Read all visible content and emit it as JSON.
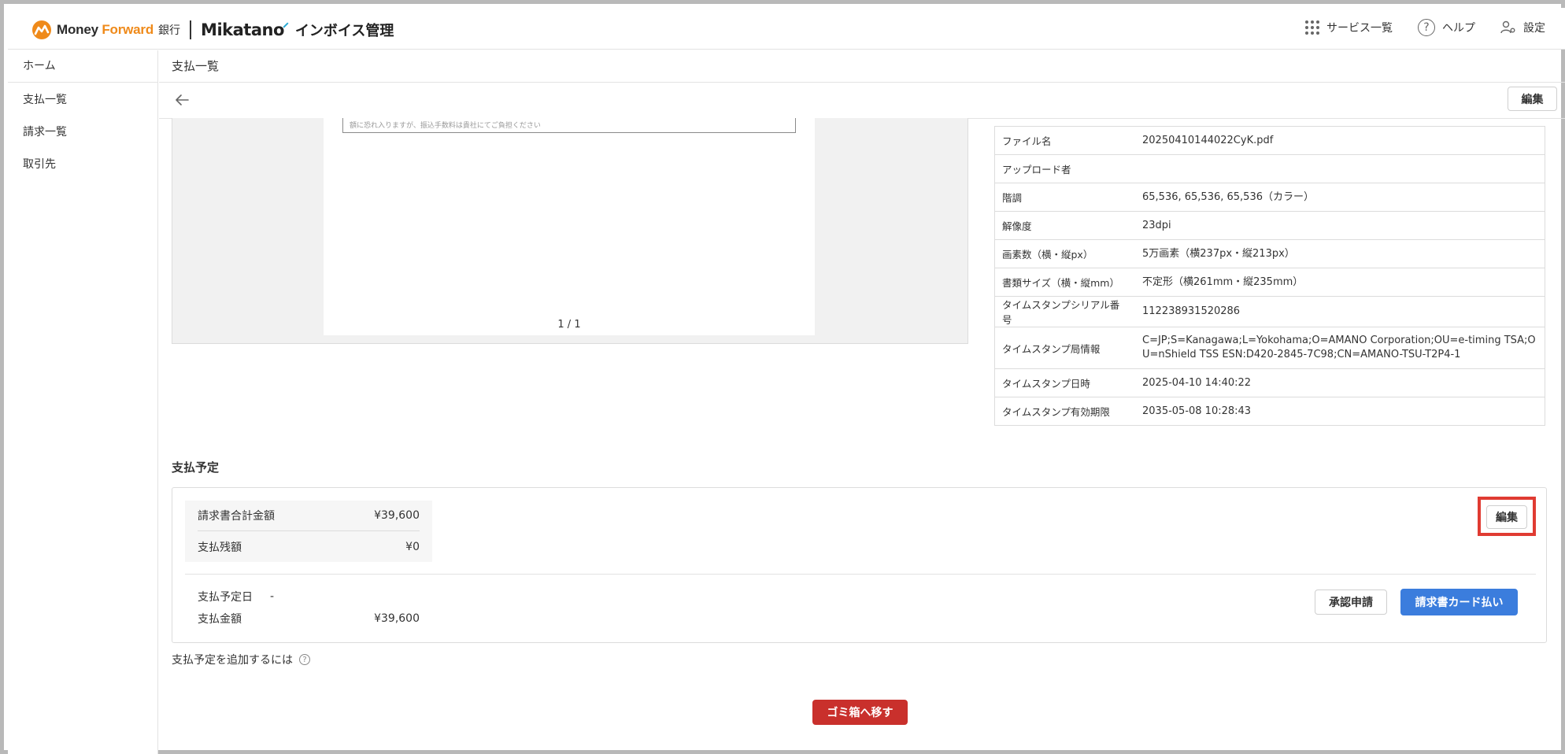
{
  "header": {
    "brand_money": "Money ",
    "brand_forward": "Forward",
    "brand_bank": "銀行",
    "brand_mikatano": "Mikatano",
    "app_name": "インボイス管理",
    "nav": [
      {
        "label": "サービス一覧",
        "icon": "grid-icon"
      },
      {
        "label": "ヘルプ",
        "icon": "help-icon"
      },
      {
        "label": "設定",
        "icon": "user-gear-icon"
      }
    ]
  },
  "sidebar": {
    "items": [
      {
        "label": "ホーム"
      },
      {
        "label": "支払一覧"
      },
      {
        "label": "請求一覧"
      },
      {
        "label": "取引先"
      }
    ]
  },
  "main": {
    "title": "支払一覧",
    "edit_label": "編集",
    "preview": {
      "snippet": "額に恐れ入りますが、振込手数料は貴社にてご負担ください",
      "pager": "1 / 1"
    },
    "meta": [
      {
        "key": "ファイル名",
        "value": "20250410144022CyK.pdf"
      },
      {
        "key": "アップロード者",
        "value": ""
      },
      {
        "key": "階調",
        "value": "65,536, 65,536, 65,536（カラー）"
      },
      {
        "key": "解像度",
        "value": "23dpi"
      },
      {
        "key": "画素数（横・縦px）",
        "value": "5万画素（横237px・縦213px）"
      },
      {
        "key": "書類サイズ（横・縦mm）",
        "value": "不定形（横261mm・縦235mm）"
      },
      {
        "key": "タイムスタンプシリアル番号",
        "value": "112238931520286"
      },
      {
        "key": "タイムスタンプ局情報",
        "value": "C=JP;S=Kanagawa;L=Yokohama;O=AMANO Corporation;OU=e-timing TSA;OU=nShield TSS ESN:D420-2845-7C98;CN=AMANO-TSU-T2P4-1"
      },
      {
        "key": "タイムスタンプ日時",
        "value": "2025-04-10 14:40:22"
      },
      {
        "key": "タイムスタンプ有効期限",
        "value": "2035-05-08 10:28:43"
      }
    ],
    "payment": {
      "section_title": "支払予定",
      "invoice_total_label": "請求書合計金額",
      "invoice_total_value": "¥39,600",
      "balance_label": "支払残額",
      "balance_value": "¥0",
      "edit_label": "編集",
      "scheduled_date_label": "支払予定日",
      "scheduled_date_value": "-",
      "amount_label": "支払金額",
      "amount_value": "¥39,600",
      "approve_label": "承認申請",
      "card_pay_label": "請求書カード払い",
      "add_hint": "支払予定を追加するには"
    },
    "trash_label": "ゴミ箱へ移す"
  },
  "colors": {
    "brand_orange": "#ef8a1a",
    "primary_blue": "#3b7ddd",
    "danger_red": "#c9302c",
    "highlight_red": "#e03b32"
  }
}
